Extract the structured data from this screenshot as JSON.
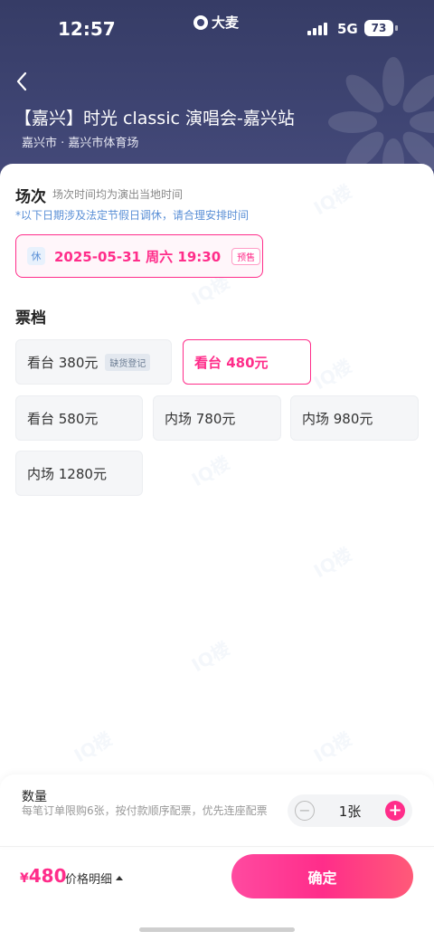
{
  "status_bar": {
    "time": "12:57",
    "brand": "大麦",
    "network": "5G",
    "battery": "73"
  },
  "header": {
    "title": "【嘉兴】时光 classic 演唱会-嘉兴站",
    "venue": "嘉兴市 · 嘉兴市体育场"
  },
  "session": {
    "title": "场次",
    "note": "场次时间均为演出当地时间",
    "warning": "*以下日期涉及法定节假日调休，请合理安排时间",
    "rest_tag": "休",
    "datetime": "2025-05-31  周六 19:30",
    "presale_tag": "预售"
  },
  "tickets": {
    "title": "票档",
    "items": [
      {
        "label": "看台 380元",
        "tag": "缺货登记",
        "selected": false
      },
      {
        "label": "看台 480元",
        "tag": "",
        "selected": true
      },
      {
        "label": "看台 580元",
        "tag": "",
        "selected": false
      },
      {
        "label": "内场 780元",
        "tag": "",
        "selected": false
      },
      {
        "label": "内场 980元",
        "tag": "",
        "selected": false
      },
      {
        "label": "内场 1280元",
        "tag": "",
        "selected": false
      }
    ]
  },
  "quantity": {
    "label": "数量",
    "description": "每笔订单限购6张，按付款顺序配票，优先连座配票",
    "minus": "−",
    "plus": "+",
    "value": "1张"
  },
  "footer": {
    "currency": "¥",
    "price": "480",
    "price_detail": "价格明细",
    "confirm": "确定"
  },
  "colors": {
    "accent": "#ff2d8a",
    "header_bg": "#3e4472",
    "info_blue": "#5a8fd6"
  }
}
